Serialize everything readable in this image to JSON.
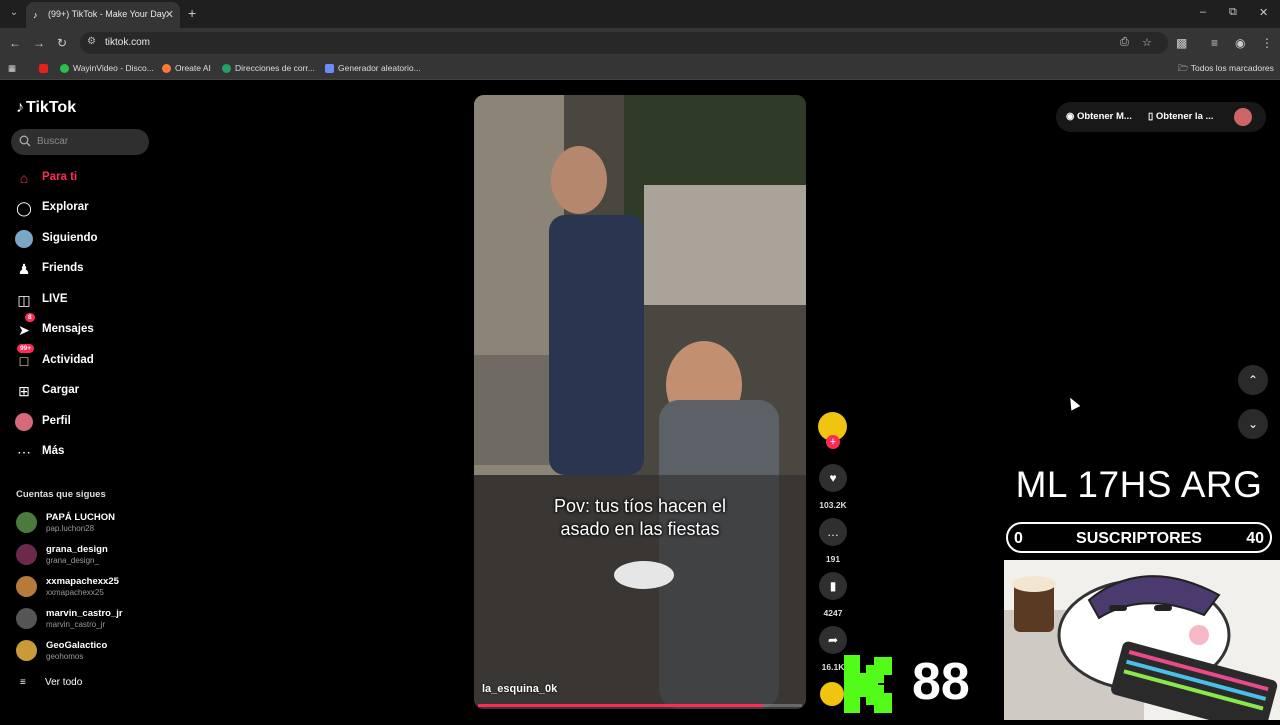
{
  "browser": {
    "tab_title": "(99+) TikTok - Make Your Day",
    "url": "tiktok.com",
    "bookmarks": [
      {
        "label": "",
        "color": "#e62117"
      },
      {
        "label": "WayinVideo - Disco...",
        "color": "#27c24c"
      },
      {
        "label": "Oreate AI",
        "color": "#ff7a30"
      },
      {
        "label": "Direcciones de corr...",
        "color": "#21a366"
      },
      {
        "label": "Generador aleatorio...",
        "color": "#6b8cff"
      }
    ],
    "all_bookmarks": "Todos los marcadores"
  },
  "sidebar": {
    "logo": "TikTok",
    "search_placeholder": "Buscar",
    "items": [
      {
        "label": "Para ti",
        "icon": "home-icon",
        "active": true
      },
      {
        "label": "Explorar",
        "icon": "compass-icon"
      },
      {
        "label": "Siguiendo",
        "icon": "following-avatar-icon"
      },
      {
        "label": "Friends",
        "icon": "friends-icon"
      },
      {
        "label": "LIVE",
        "icon": "live-icon"
      },
      {
        "label": "Mensajes",
        "icon": "messages-icon",
        "badge": "8"
      },
      {
        "label": "Actividad",
        "icon": "activity-icon",
        "badge": "99+"
      },
      {
        "label": "Cargar",
        "icon": "upload-icon"
      },
      {
        "label": "Perfil",
        "icon": "profile-icon"
      },
      {
        "label": "Más",
        "icon": "more-icon"
      }
    ],
    "following_title": "Cuentas que sigues",
    "following": [
      {
        "name": "PAPÁ LUCHON",
        "handle": "pap.luchon28",
        "color": "#4a7a3c"
      },
      {
        "name": "grana_design",
        "handle": "grana_design_",
        "color": "#6b2a4a"
      },
      {
        "name": "xxmapachexx25",
        "handle": "xxmapachexx25",
        "color": "#b87a3a"
      },
      {
        "name": "marvin_castro_jr",
        "handle": "marvin_castro_jr",
        "color": "#555555"
      },
      {
        "name": "GeoGalactico",
        "handle": "geohomos",
        "color": "#c89a3a"
      }
    ],
    "see_all": "Ver todo"
  },
  "video": {
    "caption_line1": "Pov: tus tíos hacen el",
    "caption_line2": "asado en las fiestas",
    "author": "la_esquina_0k",
    "progress": 0.88
  },
  "actions": {
    "likes": "103.2K",
    "comments": "191",
    "saves": "4247",
    "shares": "16.1K"
  },
  "topright": {
    "get_coins": "Obtener M...",
    "get_app": "Obtener la ..."
  },
  "overlay": {
    "stream_title": "ML 17HS ARG",
    "sub_left": "0",
    "sub_label": "SUSCRIPTORES",
    "sub_right": "40",
    "kick_count": "88",
    "kick_color": "#53fc18"
  }
}
